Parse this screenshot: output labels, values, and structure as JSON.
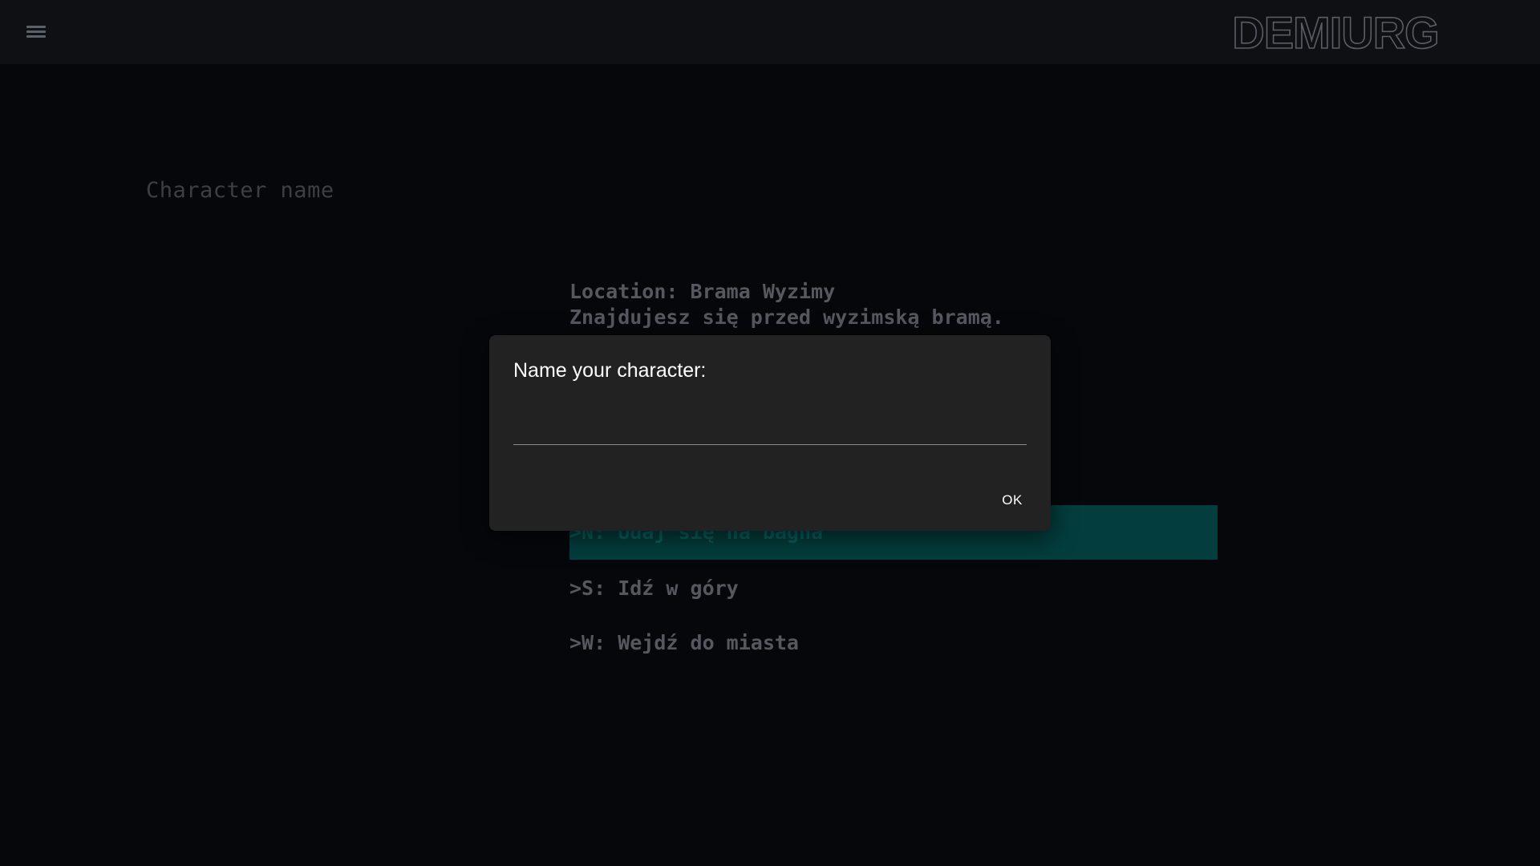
{
  "header": {
    "menu_icon": "menu-icon",
    "logo_text": "DEMIURG"
  },
  "character_name_placeholder": "Character name",
  "story": {
    "location": "Location: Brama Wyzimy",
    "description": "Znajdujesz się przed wyzimską bramą."
  },
  "choices": [
    {
      "label": ">N: Udaj się na bagna",
      "selected": true
    },
    {
      "label": ">S: Idź w góry",
      "selected": false
    },
    {
      "label": ">W: Wejdź do miasta",
      "selected": false
    }
  ],
  "dialog": {
    "title": "Name your character:",
    "input_value": "",
    "ok_label": "OK"
  },
  "colors": {
    "background": "#06070a",
    "topbar": "#0e1014",
    "highlight": "#033d3d",
    "dialog": "#222222"
  }
}
